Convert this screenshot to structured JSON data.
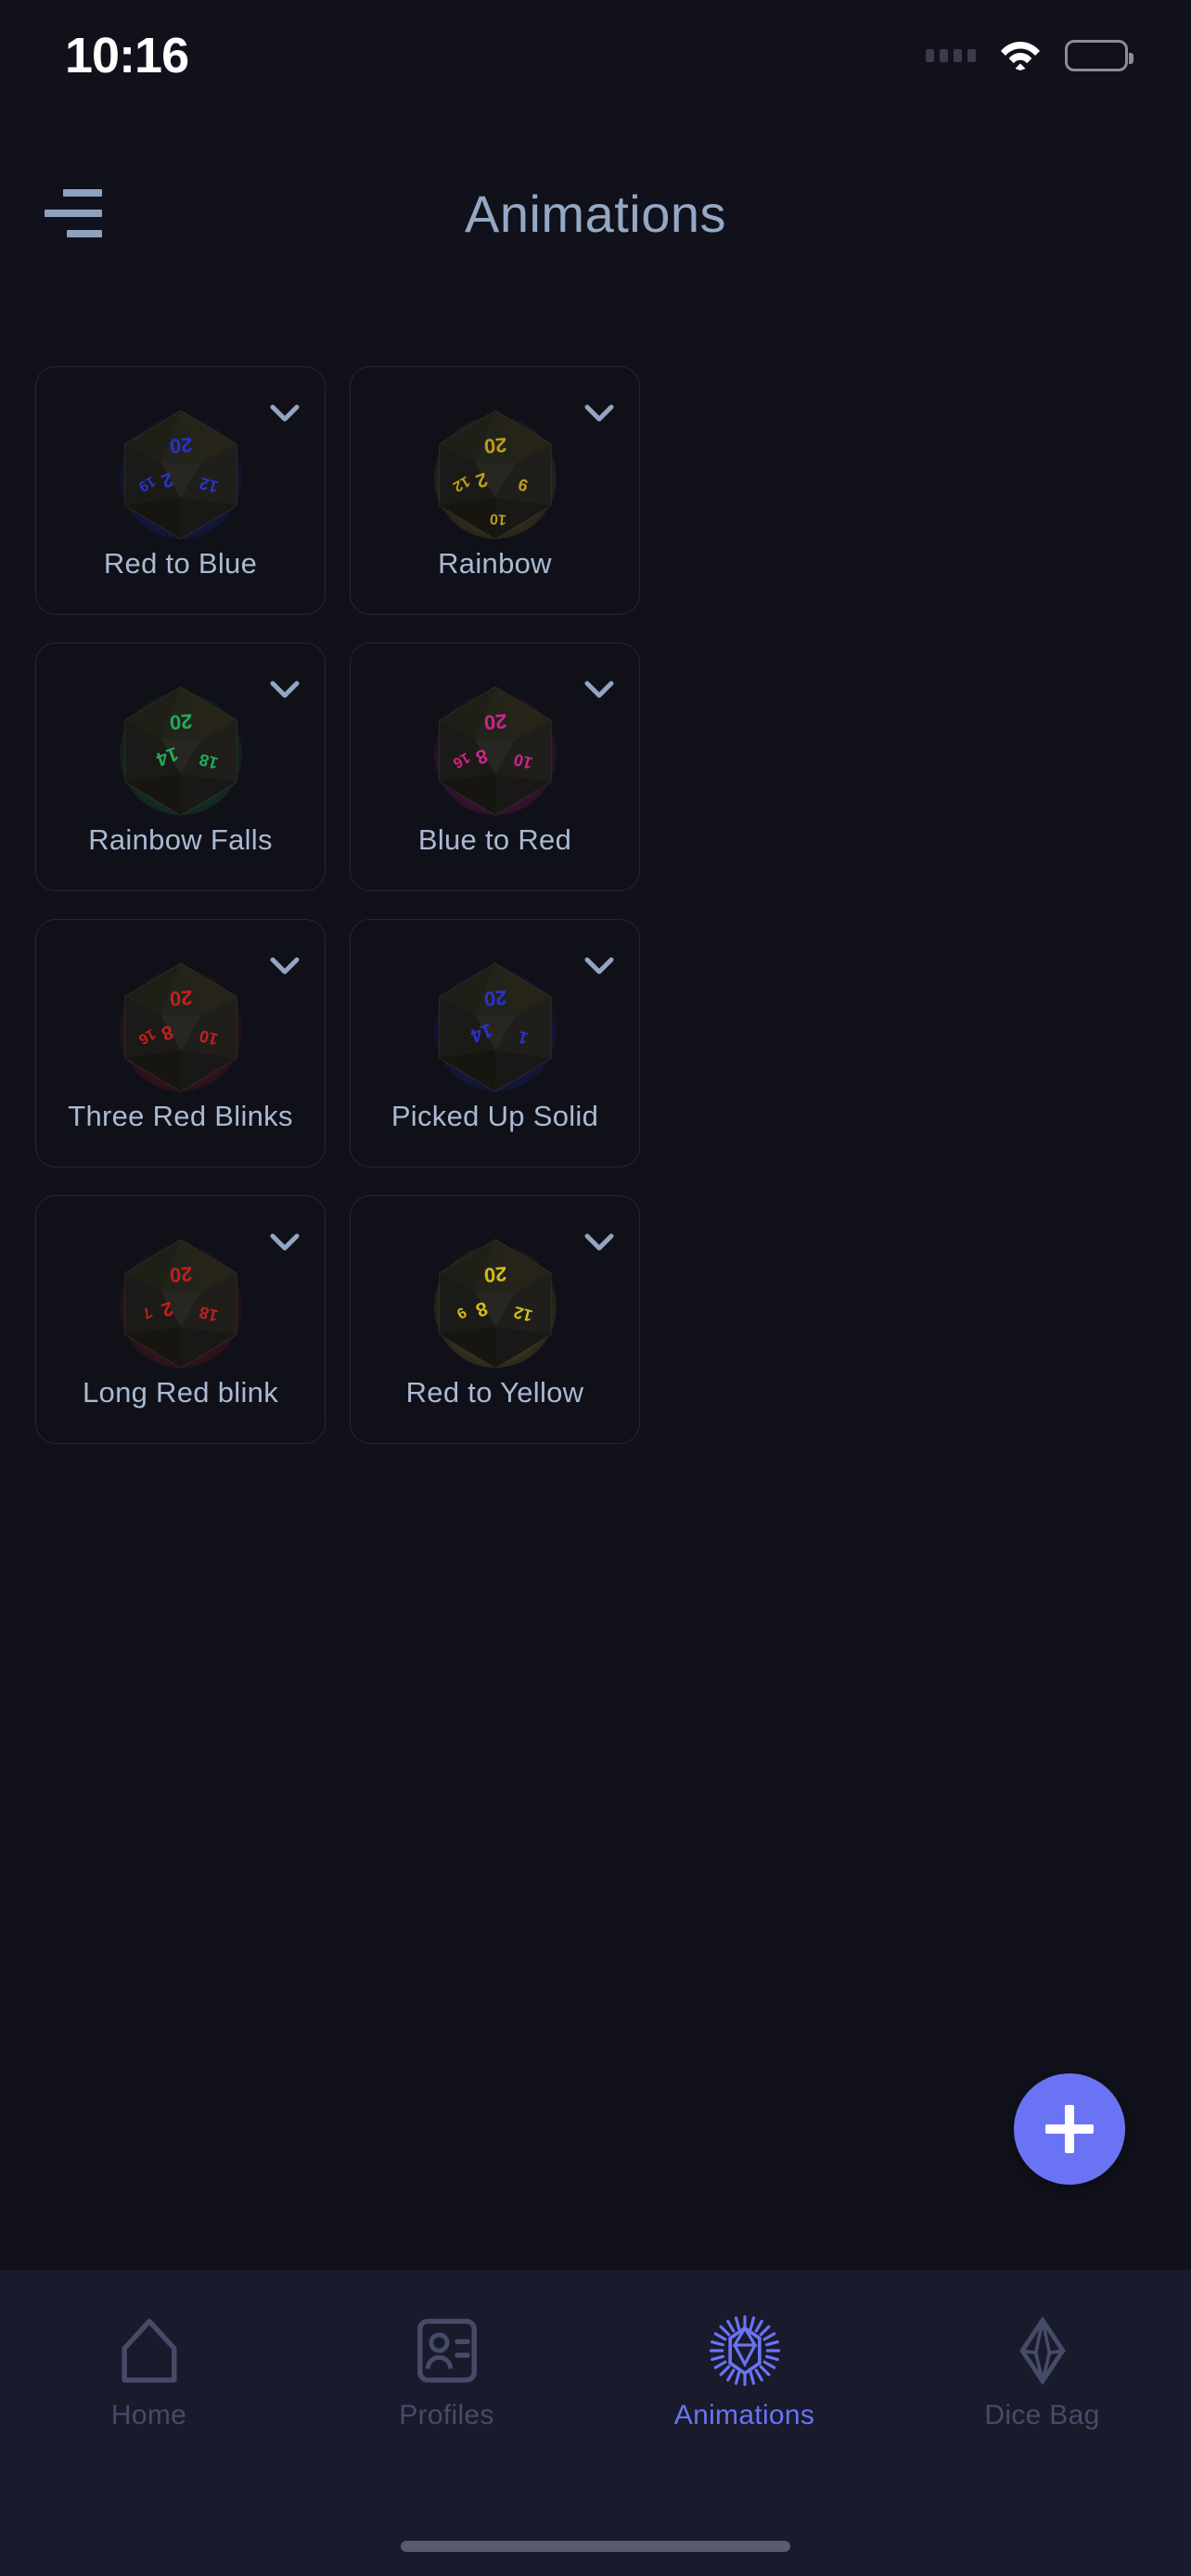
{
  "status_bar": {
    "time": "10:16",
    "signal_icon": "signal-dots-icon",
    "wifi_icon": "wifi-icon",
    "battery_icon": "battery-full-icon"
  },
  "header": {
    "menu_icon": "hamburger-menu-icon",
    "title": "Animations"
  },
  "animations": [
    {
      "name": "Red to Blue",
      "expand_icon": "chevron-down-icon",
      "die_icon": "d20-die-icon",
      "glow": "#2b34d6",
      "numbers": [
        "20",
        "2",
        "12",
        "19"
      ]
    },
    {
      "name": "Rainbow",
      "expand_icon": "chevron-down-icon",
      "die_icon": "d20-die-icon",
      "glow": "#c8a21f",
      "numbers": [
        "20",
        "2",
        "9",
        "12",
        "10"
      ]
    },
    {
      "name": "Rainbow Falls",
      "expand_icon": "chevron-down-icon",
      "die_icon": "d20-die-icon",
      "glow": "#1fb45a",
      "numbers": [
        "20",
        "14",
        "18"
      ]
    },
    {
      "name": "Blue to Red",
      "expand_icon": "chevron-down-icon",
      "die_icon": "d20-die-icon",
      "glow": "#d6268f",
      "numbers": [
        "20",
        "8",
        "10",
        "16"
      ]
    },
    {
      "name": "Three Red Blinks",
      "expand_icon": "chevron-down-icon",
      "die_icon": "d20-die-icon",
      "glow": "#cc1f1f",
      "numbers": [
        "20",
        "8",
        "10",
        "16"
      ]
    },
    {
      "name": "Picked Up Solid",
      "expand_icon": "chevron-down-icon",
      "die_icon": "d20-die-icon",
      "glow": "#2b34d6",
      "numbers": [
        "20",
        "14",
        "1"
      ]
    },
    {
      "name": "Long Red blink",
      "expand_icon": "chevron-down-icon",
      "die_icon": "d20-die-icon",
      "glow": "#cc1f1f",
      "numbers": [
        "20",
        "2",
        "18",
        "7"
      ]
    },
    {
      "name": "Red to Yellow",
      "expand_icon": "chevron-down-icon",
      "die_icon": "d20-die-icon",
      "glow": "#e0c41b",
      "numbers": [
        "20",
        "8",
        "12",
        "9"
      ]
    }
  ],
  "fab": {
    "icon": "plus-icon",
    "label": "Add Animation",
    "color": "#6b73f5"
  },
  "bottom_nav": {
    "active_color": "#6b73f5",
    "inactive_color": "#464b68",
    "items": [
      {
        "label": "Home",
        "icon": "home-icon",
        "active": false
      },
      {
        "label": "Profiles",
        "icon": "profile-card-icon",
        "active": false
      },
      {
        "label": "Animations",
        "icon": "animation-die-icon",
        "active": true
      },
      {
        "label": "Dice Bag",
        "icon": "dice-bag-icon",
        "active": false
      }
    ]
  }
}
